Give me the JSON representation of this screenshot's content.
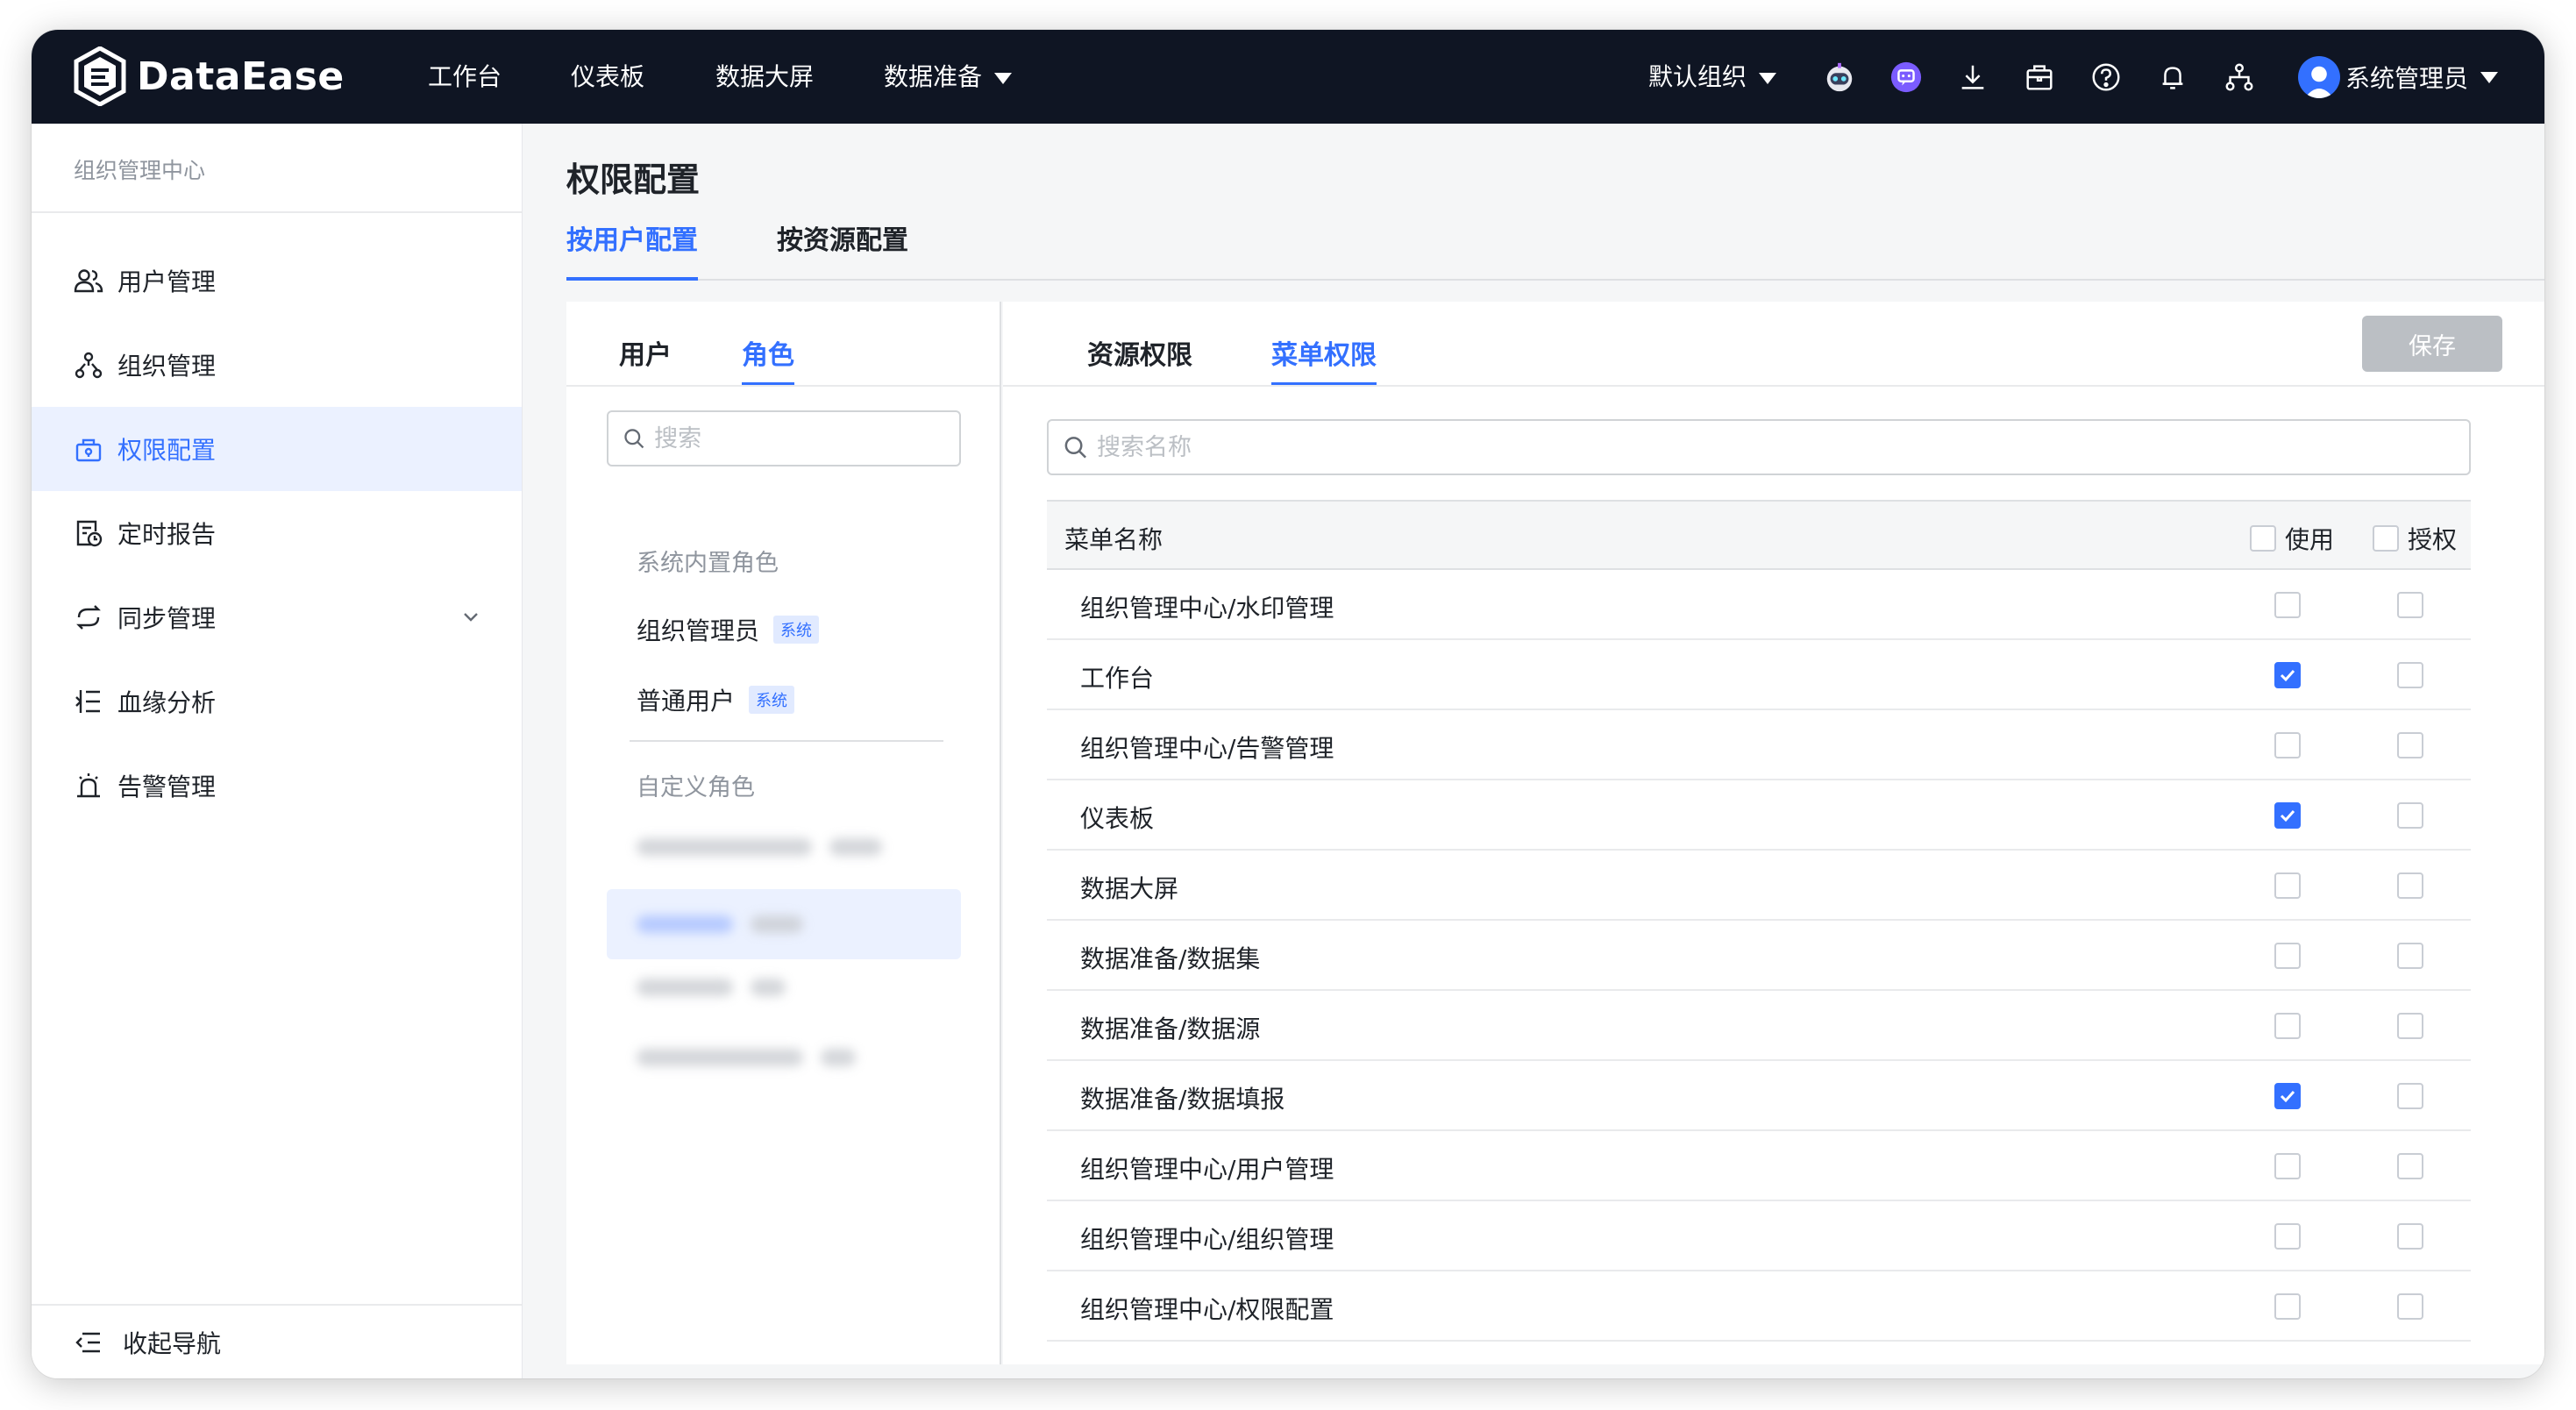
{
  "topbar": {
    "logo_text": "DataEase",
    "nav": [
      "工作台",
      "仪表板",
      "数据大屏",
      "数据准备"
    ],
    "org_selector": "默认组织",
    "user_name": "系统管理员",
    "icons": [
      "robot-icon",
      "chat-icon",
      "download-icon",
      "briefcase-icon",
      "help-icon",
      "bell-icon",
      "org-tree-icon"
    ],
    "bg_color": "#0f1523"
  },
  "sidebar": {
    "title": "组织管理中心",
    "items": [
      {
        "label": "用户管理",
        "icon": "users-icon"
      },
      {
        "label": "组织管理",
        "icon": "org-icon"
      },
      {
        "label": "权限配置",
        "icon": "permission-icon",
        "active": true
      },
      {
        "label": "定时报告",
        "icon": "report-icon"
      },
      {
        "label": "同步管理",
        "icon": "sync-icon",
        "expandable": true
      },
      {
        "label": "血缘分析",
        "icon": "lineage-icon"
      },
      {
        "label": "告警管理",
        "icon": "alarm-icon"
      }
    ],
    "collapse_label": "收起导航"
  },
  "main": {
    "title": "权限配置",
    "tabs": [
      "按用户配置",
      "按资源配置"
    ],
    "active_tab": "按用户配置"
  },
  "left_panel": {
    "tabs": [
      "用户",
      "角色"
    ],
    "active_tab": "角色",
    "search_placeholder": "搜索",
    "builtin_group": "系统内置角色",
    "builtin_roles": [
      {
        "name": "组织管理员",
        "tag": "系统"
      },
      {
        "name": "普通用户",
        "tag": "系统"
      }
    ],
    "custom_group": "自定义角色"
  },
  "right_panel": {
    "tabs": [
      "资源权限",
      "菜单权限"
    ],
    "active_tab": "菜单权限",
    "save_label": "保存",
    "search_placeholder": "搜索名称",
    "table": {
      "headers": {
        "name": "菜单名称",
        "use": "使用",
        "grant": "授权"
      },
      "rows": [
        {
          "name": "组织管理中心/水印管理",
          "use": false,
          "grant": false
        },
        {
          "name": "工作台",
          "use": true,
          "grant": false
        },
        {
          "name": "组织管理中心/告警管理",
          "use": false,
          "grant": false
        },
        {
          "name": "仪表板",
          "use": true,
          "grant": false
        },
        {
          "name": "数据大屏",
          "use": false,
          "grant": false
        },
        {
          "name": "数据准备/数据集",
          "use": false,
          "grant": false
        },
        {
          "name": "数据准备/数据源",
          "use": false,
          "grant": false
        },
        {
          "name": "数据准备/数据填报",
          "use": true,
          "grant": false
        },
        {
          "name": "组织管理中心/用户管理",
          "use": false,
          "grant": false
        },
        {
          "name": "组织管理中心/组织管理",
          "use": false,
          "grant": false
        },
        {
          "name": "组织管理中心/权限配置",
          "use": false,
          "grant": false
        }
      ]
    }
  },
  "colors": {
    "accent": "#3370ff",
    "accent_light": "#ebf1ff",
    "text": "#1f2329",
    "muted": "#8f959e"
  }
}
